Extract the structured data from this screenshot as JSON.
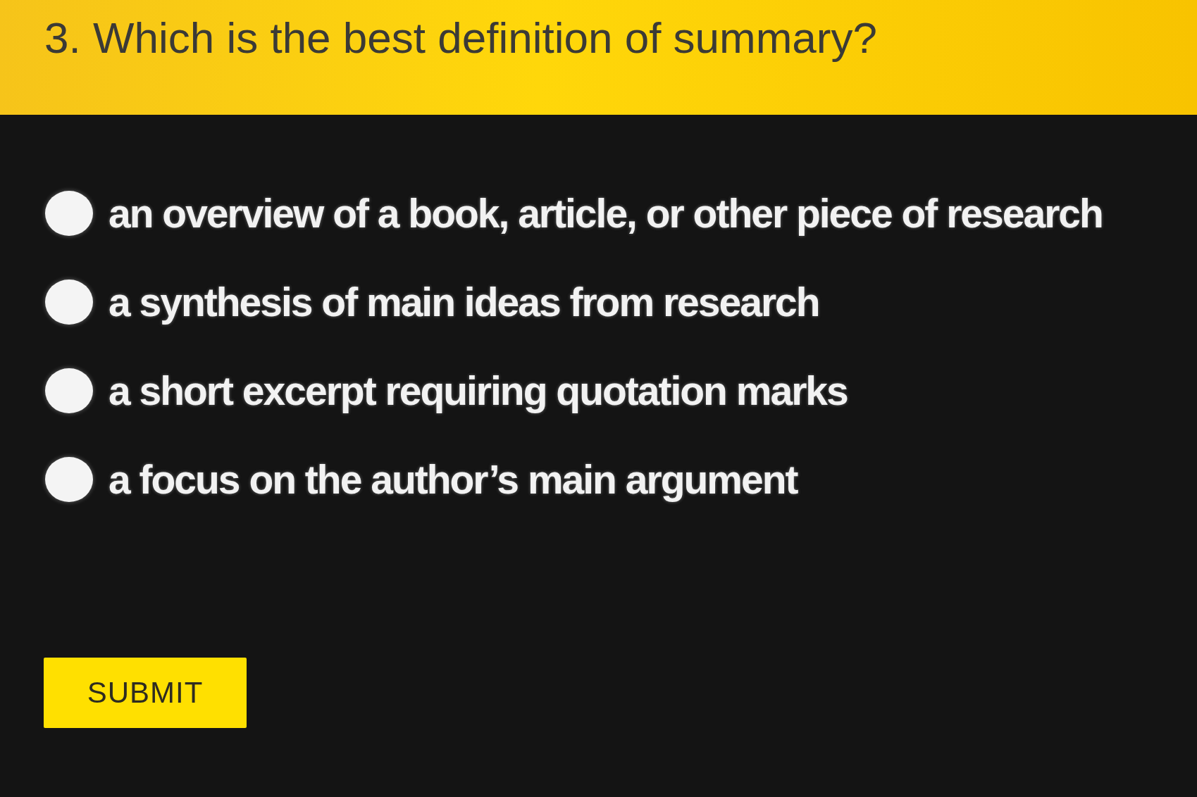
{
  "question": {
    "text": "3. Which is the best definition of summary?"
  },
  "options": [
    {
      "label": "an overview of a book, article, or other piece of research",
      "selected": false
    },
    {
      "label": "a synthesis of main ideas from research",
      "selected": false
    },
    {
      "label": "a short excerpt requiring quotation marks",
      "selected": false
    },
    {
      "label": "a focus on the author’s main argument",
      "selected": false
    }
  ],
  "submit_button": {
    "label": "SUBMIT"
  }
}
